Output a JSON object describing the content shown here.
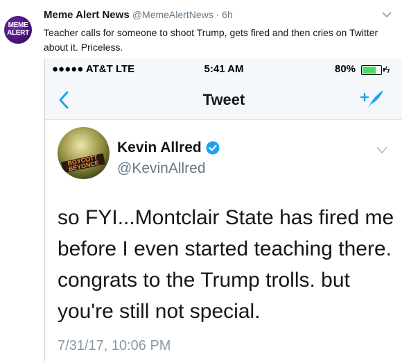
{
  "outer_tweet": {
    "avatar_text_1": "MEME",
    "avatar_text_2": "ALERT",
    "name": "Meme Alert News",
    "handle": "@MemeAlertNews · 6h",
    "text": "Teacher calls for someone to shoot Trump, gets fired and then cries on Twitter about it. Priceless."
  },
  "status_bar": {
    "carrier": "●●●●● AT&T  LTE",
    "time": "5:41 AM",
    "battery": "80%",
    "battery_level": 0.8
  },
  "nav": {
    "back_icon": "chevron-left-icon",
    "title": "Tweet",
    "compose_icon": "compose-tweet-icon"
  },
  "embedded_tweet": {
    "avatar_text": "BOYCOTT BEYONCE",
    "name": "Kevin Allred",
    "handle": "@KevinAllred",
    "verified": true,
    "text": "so FYI...Montclair State has fired me before I even started teaching there. congrats to the Trump trolls. but you're still not special.",
    "timestamp": "7/31/17, 10:06 PM"
  },
  "colors": {
    "twitter_blue": "#1da1f2",
    "gray": "#657786",
    "battery_green": "#4cd964"
  }
}
